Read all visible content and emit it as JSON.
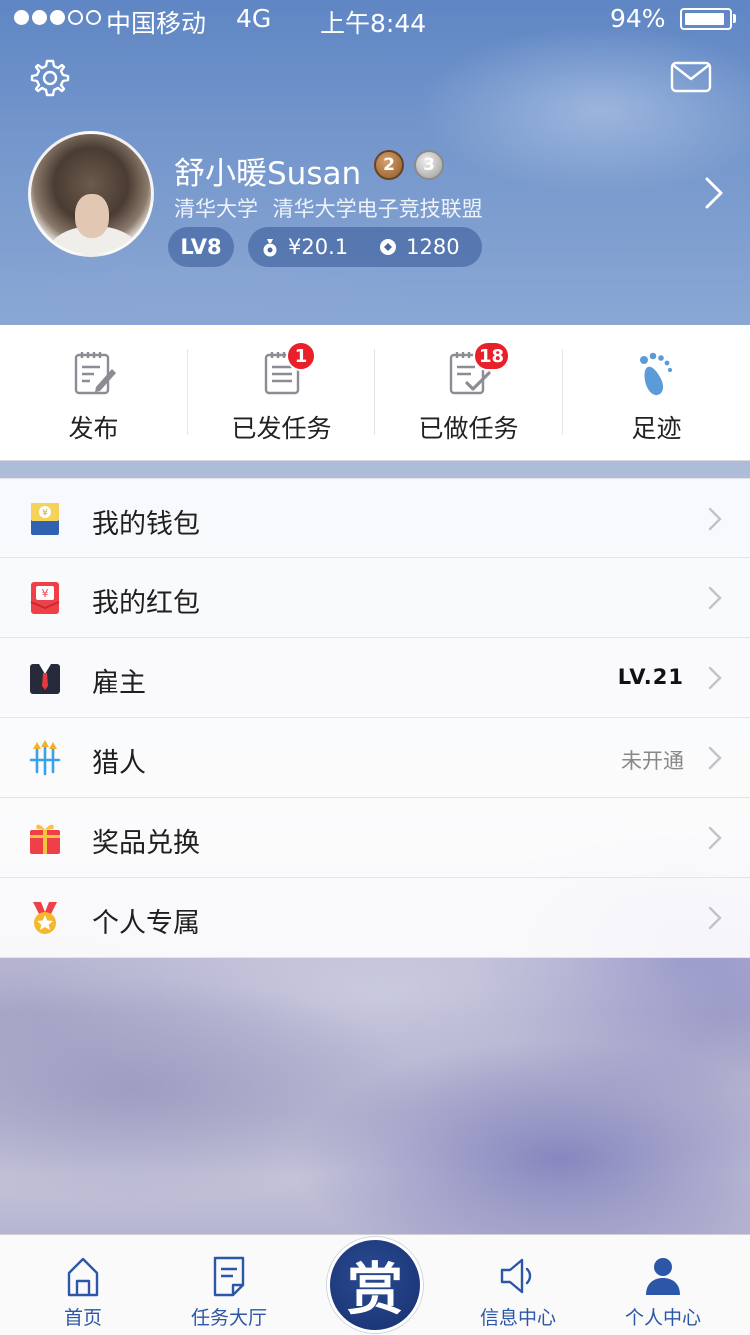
{
  "status_bar": {
    "carrier": "中国移动",
    "network": "4G",
    "time": "上午8:44",
    "battery_percent": "94%",
    "battery_level": 0.94,
    "signal_bars": 3,
    "signal_total": 5
  },
  "header": {
    "settings_icon": "gear-icon",
    "mail_icon": "mail-icon",
    "name": "舒小暖Susan",
    "medals": [
      "2",
      "3"
    ],
    "school": "清华大学  清华大学电子竞技联盟",
    "level": "LV8",
    "money": "¥20.1",
    "points": "1280"
  },
  "actions": [
    {
      "label": "发布",
      "icon": "edit-note-icon",
      "badge": ""
    },
    {
      "label": "已发任务",
      "icon": "task-list-icon",
      "badge": "1"
    },
    {
      "label": "已做任务",
      "icon": "task-done-icon",
      "badge": "18"
    },
    {
      "label": "足迹",
      "icon": "footprint-icon",
      "badge": ""
    }
  ],
  "menu": [
    {
      "label": "我的钱包",
      "value": "",
      "icon": "wallet-icon"
    },
    {
      "label": "我的红包",
      "value": "",
      "icon": "red-envelope-icon"
    },
    {
      "label": "雇主",
      "value": "LV.21",
      "icon": "employer-suit-icon"
    },
    {
      "label": "猎人",
      "value": "未开通",
      "icon": "hunter-arrows-icon"
    },
    {
      "label": "奖品兑换",
      "value": "",
      "icon": "gift-icon"
    },
    {
      "label": "个人专属",
      "value": "",
      "icon": "medal-star-icon"
    }
  ],
  "tabbar": {
    "items": [
      {
        "label": "首页",
        "icon": "home-icon"
      },
      {
        "label": "任务大厅",
        "icon": "task-hall-icon"
      },
      {
        "label": "信息中心",
        "icon": "speaker-icon"
      },
      {
        "label": "个人中心",
        "icon": "person-icon"
      }
    ],
    "center_label": "赏"
  },
  "colors": {
    "accent": "#2c56a6",
    "badge": "#e9202a",
    "header_blue": "#6f93c8"
  }
}
